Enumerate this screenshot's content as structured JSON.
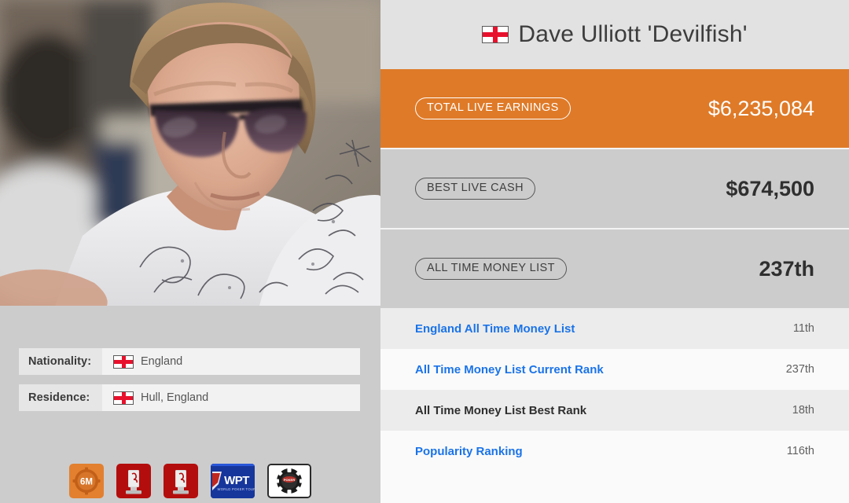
{
  "player": {
    "name": "Dave Ulliott 'Devilfish'",
    "flag_icon": "england-flag-icon"
  },
  "stats": [
    {
      "label": "TOTAL LIVE EARNINGS",
      "value": "$6,235,084",
      "theme": "orange"
    },
    {
      "label": "BEST LIVE CASH",
      "value": "$674,500",
      "theme": "grey"
    },
    {
      "label": "ALL TIME MONEY LIST",
      "value": "237th",
      "theme": "grey"
    }
  ],
  "rankings": [
    {
      "label": "England All Time Money List",
      "value": "11th",
      "is_link": true
    },
    {
      "label": "All Time Money List Current Rank",
      "value": "237th",
      "is_link": true
    },
    {
      "label": "All Time Money List Best Rank",
      "value": "18th",
      "is_link": false
    },
    {
      "label": "Popularity Ranking",
      "value": "116th",
      "is_link": true
    }
  ],
  "info": [
    {
      "label": "Nationality:",
      "value": "England",
      "flag": "england-flag-icon"
    },
    {
      "label": "Residence:",
      "value": "Hull, England",
      "flag": "england-flag-icon"
    }
  ],
  "badges": [
    {
      "name": "six-million-badge",
      "text": "6M"
    },
    {
      "name": "trophy-badge-1",
      "text": ""
    },
    {
      "name": "trophy-badge-2",
      "text": ""
    },
    {
      "name": "wpt-badge",
      "text": "WPT",
      "subtext": "WORLD POKER TOUR"
    },
    {
      "name": "poker-chip-badge",
      "text": ""
    }
  ],
  "colors": {
    "accent_orange": "#df7a28",
    "band_grey": "#cccccc",
    "header_grey": "#e2e2e2",
    "link_blue": "#1a73e8",
    "flag_red": "#e8112d"
  }
}
